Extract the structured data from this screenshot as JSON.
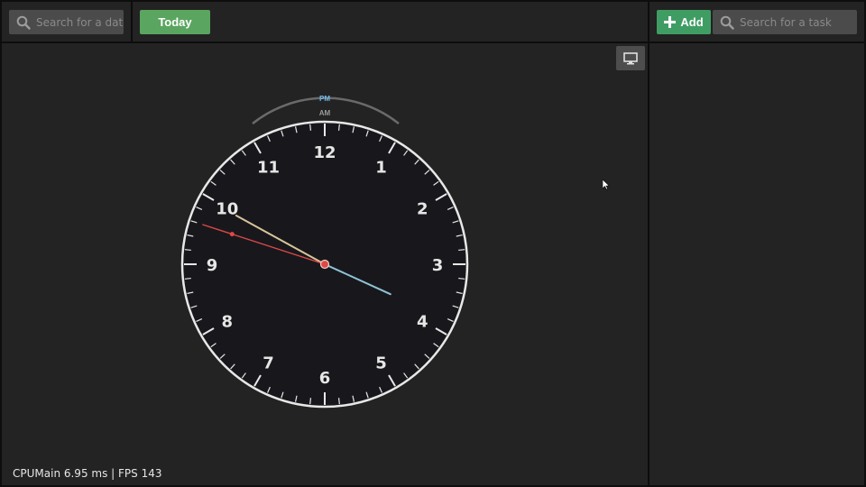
{
  "toolbar": {
    "date_search_placeholder": "Search for a date",
    "today_label": "Today",
    "add_label": "Add",
    "task_search_placeholder": "Search for a task"
  },
  "clock": {
    "pm_label": "PM",
    "am_label": "AM",
    "numerals": [
      "12",
      "1",
      "2",
      "3",
      "4",
      "5",
      "6",
      "7",
      "8",
      "9",
      "10",
      "11"
    ],
    "time": {
      "hour": 3,
      "minute": 49,
      "second": 48,
      "period": "PM"
    },
    "colors": {
      "face": "#18181c",
      "rim": "#e8e8e8",
      "hour_hand": "#8fc3d6",
      "minute_hand": "#d8c59a",
      "second_hand": "#e04848",
      "pm_label": "#6fb8e6",
      "am_label": "#9a9a9a"
    }
  },
  "status": {
    "perf_text": "CPUMain  6.95 ms | FPS 143"
  },
  "icons": {
    "search": "search-icon",
    "add": "plus-icon",
    "monitor": "monitor-icon"
  }
}
